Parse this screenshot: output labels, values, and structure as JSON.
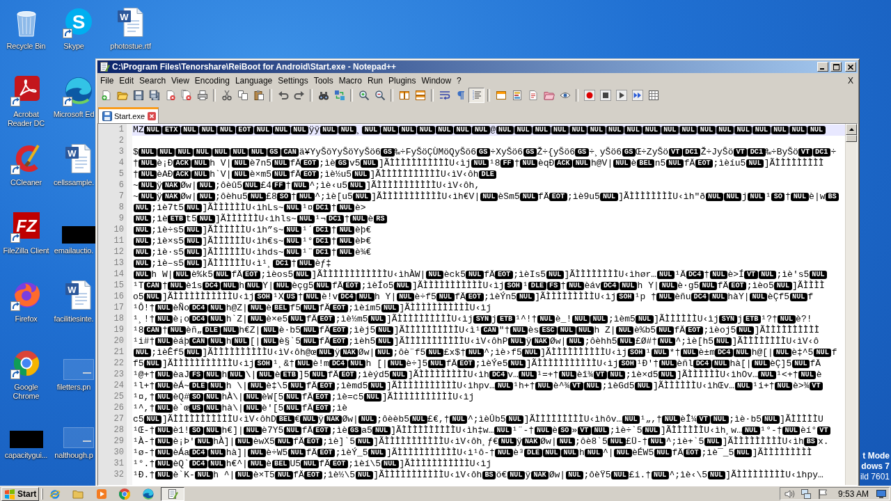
{
  "desktop": {
    "columns": [
      [
        {
          "label": "Recycle Bin",
          "shortcut": false
        },
        {
          "label": "Acrobat Reader DC",
          "shortcut": true
        },
        {
          "label": "CCleaner",
          "shortcut": true
        },
        {
          "label": "FileZilla Client",
          "shortcut": true,
          "glyph": "FZ"
        },
        {
          "label": "Firefox",
          "shortcut": true
        },
        {
          "label": "Google Chrome",
          "shortcut": true
        },
        {
          "label": "capacitygui...",
          "shortcut": false
        }
      ],
      [
        {
          "label": "Skype",
          "shortcut": true,
          "glyph": "S"
        },
        {
          "label": "Microsoft Ed",
          "shortcut": true
        },
        {
          "label": "cellssample.",
          "shortcut": false,
          "glyph": "W"
        },
        {
          "label": "emailauctio.",
          "shortcut": false
        },
        {
          "label": "facilitiesinte.",
          "shortcut": false,
          "glyph": "W"
        },
        {
          "label": "filetters.pn",
          "shortcut": false
        },
        {
          "label": "nalthough.p",
          "shortcut": false
        }
      ],
      [
        {
          "label": "photostue.rtf",
          "shortcut": false,
          "glyph": "W"
        }
      ]
    ],
    "notice": [
      "t Mode",
      "dows 7",
      "ild 7601"
    ]
  },
  "window": {
    "title": "C:\\Program Files\\Tenorshare\\ReiBoot for Android\\Start.exe - Notepad++"
  },
  "menu": {
    "items": [
      "File",
      "Edit",
      "Search",
      "View",
      "Encoding",
      "Language",
      "Settings",
      "Tools",
      "Macro",
      "Run",
      "Plugins",
      "Window",
      "?"
    ],
    "close": "X"
  },
  "toolbar": [
    [
      {
        "pressed": false
      },
      {
        "pressed": false
      },
      {
        "pressed": false
      },
      {
        "pressed": false
      },
      {
        "pressed": false
      },
      {
        "pressed": false
      },
      {
        "pressed": false
      }
    ],
    [
      {
        "pressed": false
      },
      {
        "pressed": false
      },
      {
        "pressed": false
      }
    ],
    [
      {
        "pressed": false
      },
      {
        "pressed": false
      }
    ],
    [
      {
        "pressed": false
      },
      {
        "pressed": false
      }
    ],
    [
      {
        "pressed": false
      },
      {
        "pressed": false
      }
    ],
    [
      {
        "pressed": false
      },
      {
        "pressed": false
      }
    ],
    [
      {
        "pressed": false
      },
      {
        "pressed": false
      },
      {
        "pressed": true
      }
    ],
    [
      {
        "pressed": false
      },
      {
        "pressed": false
      },
      {
        "pressed": false
      },
      {
        "pressed": false
      },
      {
        "pressed": false
      }
    ],
    [
      {
        "pressed": false
      },
      {
        "pressed": false
      },
      {
        "pressed": false
      },
      {
        "pressed": false
      },
      {
        "pressed": false
      }
    ]
  ],
  "tabs": [
    {
      "label": "Start.exe",
      "selected": true,
      "modified": false
    }
  ],
  "editor": {
    "lines": [
      {
        "number": "1",
        "current": true,
        "segments": [
          "MZ",
          [
            "NUL",
            "ETX",
            "NUL",
            "NUL",
            "NUL",
            "EOT",
            "NUL",
            "NUL",
            "NUL"
          ],
          "ÿÿ",
          [
            "NUL",
            "NUL"
          ],
          "¸",
          [
            "NUL",
            "NUL",
            "NUL",
            "NUL",
            "NUL",
            "NUL",
            "NUL"
          ],
          "@",
          [
            "NUL",
            "NUL",
            "NUL",
            "NUL",
            "NUL",
            "NUL",
            "NUL",
            "NUL",
            "NUL",
            "NUL",
            "NUL",
            "NUL",
            "NUL",
            "NUL",
            "NUL",
            "NUL",
            "NUL",
            "NUL"
          ]
        ]
      },
      {
        "number": "2",
        "current": false
      },
      {
        "number": "3",
        "current": false,
        "segments": [
          "$",
          [
            "NUL",
            "NUL",
            "NUL",
            "NUL",
            "NUL",
            "NUL",
            "NUL",
            "GS",
            "CAN"
          ],
          "ä¥YyŠöYyŠöYyŠö6",
          [
            "GS"
          ],
          "‰÷FyŠöÇÙMöQyŠö6",
          [
            "GS"
          ],
          "÷XyŠö6",
          [
            "GS"
          ],
          "Ž÷{yŠö6",
          [
            "GS"
          ],
          "÷¸yŠö6",
          [
            "GS"
          ],
          "Œ÷ZyŠö",
          [
            "VT",
            "DC1"
          ],
          "Ž÷JyŠö",
          [
            "VT",
            "DC1"
          ],
          "‰÷ByŠö",
          [
            "VT",
            "DC1"
          ],
          "÷"
        ]
      },
      {
        "number": "4",
        "current": false,
        "segments": [
          "†",
          [
            "NUL"
          ],
          "è¡Ð",
          [
            "ACK",
            "NUL"
          ],
          "h V|",
          [
            "NUL"
          ],
          "è7n5",
          [
            "NUL"
          ],
          "fÄ",
          [
            "EOT"
          ],
          ";ìè",
          [
            "GS"
          ],
          "v5",
          [
            "NUL"
          ],
          "]ÃÌÌÌÌÌÌÌÌÌÌÌU‹ìj",
          [
            "NUL"
          ],
          "¹8",
          [
            "FF"
          ],
          "†",
          [
            "NUL"
          ],
          "èqÐ",
          [
            "ACK",
            "NUL"
          ],
          "h@V|",
          [
            "NUL"
          ],
          "è",
          [
            "BEL"
          ],
          "n5",
          [
            "NUL"
          ],
          "fÄ",
          [
            "EOT"
          ],
          ";ìèíu5",
          [
            "NUL"
          ],
          "]ÃÌÌÌÌÌÌÌÌÌ"
        ]
      },
      {
        "number": "5",
        "current": false,
        "segments": [
          "†",
          [
            "NUL"
          ],
          "èAÐ",
          [
            "ACK",
            "NUL"
          ],
          "h`V|",
          [
            "NUL"
          ],
          "è×m5",
          [
            "NUL"
          ],
          "fÄ",
          [
            "EOT"
          ],
          ";ìè½u5",
          [
            "NUL"
          ],
          "]ÃÌÌÌÌÌÌÌÌÌÌÌU‹ìV‹ôh",
          [
            "DLE"
          ]
        ]
      },
      {
        "number": "6",
        "current": false,
        "segments": [
          "~",
          [
            "NUL"
          ],
          "ÿ",
          [
            "NAK"
          ],
          "Øw|",
          [
            "NUL"
          ],
          ";ôèû5",
          [
            "NUL"
          ],
          "£4",
          [
            "FF"
          ],
          "†",
          [
            "NUL"
          ],
          "^;ìè‹u5",
          [
            "NUL"
          ],
          "]ÃÌÌÌÌÌÌÌÌÌÌÌU‹ìV‹ôh,"
        ]
      },
      {
        "number": "7",
        "current": false,
        "segments": [
          "~",
          [
            "NUL"
          ],
          "ÿ",
          [
            "NAK"
          ],
          "Øw|",
          [
            "NUL"
          ],
          ";ôèhu5",
          [
            "NUL"
          ],
          "£8",
          [
            "SO"
          ],
          "†",
          [
            "NUL"
          ],
          "^;ìè[u5",
          [
            "NUL"
          ],
          "]ÃÌÌÌÌÌÌÌÌÌÌÌU‹ìh€V|",
          [
            "NUL"
          ],
          "èSm5",
          [
            "NUL"
          ],
          "fÄ",
          [
            "EOT"
          ],
          ";ìè9u5",
          [
            "NUL"
          ],
          "]ÃÌÌÌÌÌÌÌÌU‹ìh\"ð",
          [
            "NUL",
            "NUL"
          ],
          "j",
          [
            "NUL"
          ],
          "¹",
          [
            "SO"
          ],
          "†",
          [
            "NUL"
          ],
          "è|w",
          [
            "BS"
          ]
        ]
      },
      {
        "number": "8",
        "current": false,
        "segments": [
          [
            "NUL"
          ],
          ";ìè7t5",
          [
            "NUL"
          ],
          "]ÃÌÌÌÌÌÌU‹ìhLs~",
          [
            "NUL"
          ],
          "¹¤",
          [
            "DC1"
          ],
          "†",
          [
            "NUL"
          ],
          "è>"
        ]
      },
      {
        "number": "9",
        "current": false,
        "segments": [
          [
            "NUL"
          ],
          ";ìè",
          [
            "ETB"
          ],
          "t5",
          [
            "NUL"
          ],
          "]ÃÌÌÌÌÌÌU‹ìhls~",
          [
            "NUL"
          ],
          "¹¬",
          [
            "DC1"
          ],
          "†",
          [
            "NUL"
          ],
          "è",
          [
            "RS"
          ]
        ]
      },
      {
        "number": "10",
        "current": false,
        "segments": [
          [
            "NUL"
          ],
          ";ìè÷s5",
          [
            "NUL"
          ],
          "]ÃÌÌÌÌÌÌU‹ìh”s~",
          [
            "NUL"
          ],
          "¹´",
          [
            "DC1"
          ],
          "†",
          [
            "NUL"
          ],
          "èþ€"
        ]
      },
      {
        "number": "11",
        "current": false,
        "segments": [
          [
            "NUL"
          ],
          ";ìè×s5",
          [
            "NUL"
          ],
          "]ÃÌÌÌÌÌÌU‹ìh€s~",
          [
            "NUL"
          ],
          "¹°",
          [
            "DC1"
          ],
          "†",
          [
            "NUL"
          ],
          "èÞ€"
        ]
      },
      {
        "number": "12",
        "current": false,
        "segments": [
          [
            "NUL"
          ],
          ";ìè·s5",
          [
            "NUL"
          ],
          "]ÃÌÌÌÌÌÌU‹ìhds~",
          [
            "NUL"
          ],
          "¹¨",
          [
            "DC1"
          ],
          "†",
          [
            "NUL"
          ],
          "è¾€"
        ]
      },
      {
        "number": "13",
        "current": false,
        "segments": [
          [
            "NUL"
          ],
          ";ìè–s5",
          [
            "NUL"
          ],
          "]ÃÌÌÌÌÌÌU‹ì¹¸",
          [
            "DC1"
          ],
          "†",
          [
            "NUL"
          ],
          "èƒ‡"
        ]
      },
      {
        "number": "14",
        "current": false,
        "segments": [
          [
            "NUL"
          ],
          "h W|",
          [
            "NUL"
          ],
          "è%k5",
          [
            "NUL"
          ],
          "fÄ",
          [
            "EOT"
          ],
          ";ìèos5",
          [
            "NUL"
          ],
          "]ÃÌÌÌÌÌÌÌÌÌÌÌÌU‹ìhÀW|",
          [
            "NUL"
          ],
          "èck5",
          [
            "NUL"
          ],
          "fÄ",
          [
            "EOT"
          ],
          ";ìèIs5",
          [
            "NUL"
          ],
          "]ÃÌÌÌÌÌÌÌÌU‹ìhør…",
          [
            "NUL"
          ],
          "¹Ä",
          [
            "DC4"
          ],
          "†",
          [
            "NUL"
          ],
          "è>Í",
          [
            "VT",
            "NUL"
          ],
          ";ìè's5",
          [
            "NUL"
          ]
        ]
      },
      {
        "number": "15",
        "current": false,
        "segments": [
          "¹T",
          [
            "CAN"
          ],
          "†",
          [
            "NUL"
          ],
          "è1s",
          [
            "DC4",
            "NUL"
          ],
          "h",
          [
            "NUL"
          ],
          "Y|",
          [
            "NUL"
          ],
          "èçg5",
          [
            "NUL"
          ],
          "fÄ",
          [
            "EOT"
          ],
          ";ìèÍo5",
          [
            "NUL"
          ],
          "]ÃÌÌÌÌÌÌÌÌÌÌÌU‹ìj",
          [
            "SOH"
          ],
          "¹",
          [
            "DLE",
            "FS"
          ],
          "†",
          [
            "NUL"
          ],
          "èáv",
          [
            "DC4",
            "NUL"
          ],
          "h Y|",
          [
            "NUL"
          ],
          "è·g5",
          [
            "NUL"
          ],
          "fÄ",
          [
            "EOT"
          ],
          ";ìèo5",
          [
            "NUL"
          ],
          "]ÃÌÌÌÌ"
        ]
      },
      {
        "number": "16",
        "current": false,
        "segments": [
          "o5",
          [
            "NUL"
          ],
          "]ÃÌÌÌÌÌÌÌÌÌÌÌU‹ìj",
          [
            "SOH"
          ],
          "¹X",
          [
            "US"
          ],
          "†",
          [
            "NUL"
          ],
          "è!v",
          [
            "DC4",
            "NUL"
          ],
          "h Y|",
          [
            "NUL"
          ],
          "è÷f5",
          [
            "NUL"
          ],
          "fÄ",
          [
            "EOT"
          ],
          ";ìèÝn5",
          [
            "NUL"
          ],
          "]ÃÌÌÌÌÌÌÌÌÌU‹ìj",
          [
            "SOH"
          ],
          "¹p †",
          [
            "NUL"
          ],
          "èñu",
          [
            "DC4",
            "NUL"
          ],
          "hàY|",
          [
            "NUL"
          ],
          "èÇf5",
          [
            "NUL"
          ],
          "f"
        ]
      },
      {
        "number": "17",
        "current": false,
        "segments": [
          "¹Ô!†",
          [
            "NUL"
          ],
          "èÑo",
          [
            "DC4",
            "NUL"
          ],
          "h@Z|",
          [
            "NUL"
          ],
          "è",
          [
            "BEL"
          ],
          "f5",
          [
            "NUL"
          ],
          "fÄ",
          [
            "EOT"
          ],
          ";ìèím5",
          [
            "NUL"
          ],
          "]ÃÌÌÌÌÌÌÌÌÌÌÌU‹ìj"
        ]
      },
      {
        "number": "18",
        "current": false,
        "segments": [
          "¹¸!†",
          [
            "NUL"
          ],
          "è¡o",
          [
            "DC4",
            "NUL"
          ],
          "h`Z|",
          [
            "NUL"
          ],
          "è×e5",
          [
            "NUL"
          ],
          "fÄ",
          [
            "EOT"
          ],
          ";ìè½m5",
          [
            "NUL"
          ],
          "]ÃÌÌÌÌÌÌÌÌÌÌU‹ìj",
          [
            "SYN"
          ],
          "j",
          [
            "ETB"
          ],
          "¹^!†",
          [
            "NUL"
          ],
          "è_!",
          [
            "NUL",
            "NUL"
          ],
          ";ìèm5",
          [
            "NUL"
          ],
          "]ÃÌÌÌÌÌÌU‹ìj",
          [
            "SYN"
          ],
          "j",
          [
            "ETB"
          ],
          "¹?†",
          [
            "NUL"
          ],
          "è?!"
        ]
      },
      {
        "number": "19",
        "current": false,
        "segments": [
          "¹8",
          [
            "CAN"
          ],
          "†",
          [
            "NUL"
          ],
          "èñ„",
          [
            "DLE",
            "NUL"
          ],
          "h€Z|",
          [
            "NUL"
          ],
          "è·b5",
          [
            "NUL"
          ],
          "fÄ",
          [
            "EOT"
          ],
          ";ìèj5",
          [
            "NUL"
          ],
          "]ÃÌÌÌÌÌÌÌÌÌÌU‹ì¹",
          [
            "CAN"
          ],
          "\"†",
          [
            "NUL"
          ],
          "ès",
          [
            "ESC",
            "NUL",
            "NUL"
          ],
          "h Z|",
          [
            "NUL"
          ],
          "è%b5",
          [
            "NUL"
          ],
          "fÄ",
          [
            "EOT"
          ],
          ";ìèoj5",
          [
            "NUL"
          ],
          "]ÃÌÌÌÌÌÌÌÌÌÌ"
        ]
      },
      {
        "number": "20",
        "current": false,
        "segments": [
          "¹i#†",
          [
            "NUL"
          ],
          "èáþ",
          [
            "CAN",
            "NUL"
          ],
          "h",
          [
            "NUL"
          ],
          "[|",
          [
            "NUL"
          ],
          "è§`5",
          [
            "NUL"
          ],
          "fÄ",
          [
            "EOT"
          ],
          ";ìèh5",
          [
            "NUL"
          ],
          "]ÃÌÌÌÌÌÌÌÌÌÌÌU‹ìV‹ôhP",
          [
            "NUL"
          ],
          "ÿ",
          [
            "NAK"
          ],
          "Øw|",
          [
            "NUL"
          ],
          ";ôèhh5",
          [
            "NUL"
          ],
          "£Ø#†",
          [
            "NUL"
          ],
          "^;ìè[h5",
          [
            "NUL"
          ],
          "]ÃÌÌÌÌÌÌÌÌU‹ìV‹ô"
        ]
      },
      {
        "number": "21",
        "current": false,
        "segments": [
          [
            "NUL"
          ],
          ";ìèÊf5",
          [
            "NUL"
          ],
          "]ÃÌÌÌÌÌÌÌÌÌÌU‹ìV‹ôh@œ",
          [
            "NUL"
          ],
          "ÿ",
          [
            "NAK"
          ],
          "Øw|",
          [
            "NUL"
          ],
          ";ôè¨f5",
          [
            "NUL"
          ],
          "£x$†",
          [
            "NUL"
          ],
          "^;ìè›f5",
          [
            "NUL"
          ],
          "]ÃÌÌÌÌÌÌÌÌÌÌU‹ìj",
          [
            "SOH"
          ],
          "¹",
          [
            "NUL"
          ],
          "*†",
          [
            "NUL"
          ],
          "è±m",
          [
            "DC4",
            "NUL"
          ],
          "h@[|",
          [
            "NUL"
          ],
          "è‡^5",
          [
            "NUL"
          ],
          "f"
        ]
      },
      {
        "number": "22",
        "current": false,
        "segments": [
          "f5",
          [
            "NUL"
          ],
          "]ÃÌÌÌÌÌÌÌÌÌÌÌU‹ìj",
          [
            "SOH"
          ],
          "¹¸&†",
          [
            "NUL"
          ],
          "è!m",
          [
            "DC4",
            "NUL"
          ],
          "h [|",
          [
            "NUL"
          ],
          "è÷]5",
          [
            "NUL"
          ],
          "fÄ",
          [
            "EOT"
          ],
          ";ìèÝe5",
          [
            "NUL"
          ],
          "]ÃÌÌÌÌÌÌÌÌÌÌÌU‹ìj",
          [
            "SOH"
          ],
          "¹Ð'†",
          [
            "NUL"
          ],
          "èñl",
          [
            "DC4",
            "NUL"
          ],
          "hà[|",
          [
            "NUL"
          ],
          "èÇ]5",
          [
            "NUL"
          ],
          "fÄ"
        ]
      },
      {
        "number": "23",
        "current": false,
        "segments": [
          "¹@+†",
          [
            "NUL"
          ],
          "èaJ",
          [
            "FS",
            "NUL"
          ],
          "h",
          [
            "NUL"
          ],
          "\\|",
          [
            "NUL"
          ],
          "è",
          [
            "ETB"
          ],
          "]5",
          [
            "NUL"
          ],
          "fÄ",
          [
            "EOT"
          ],
          ";ìèýd5",
          [
            "NUL"
          ],
          "]ÃÌÌÌÌÌÌÌÌÌU‹ìh",
          [
            "DC4"
          ],
          "v…",
          [
            "NUL"
          ],
          "¹=+†",
          [
            "NUL"
          ],
          "èî¾",
          [
            "VT",
            "NUL"
          ],
          ";ìè×d5",
          [
            "NUL"
          ],
          "]ÃÌÌÌÌÌÌU‹ìhOv…",
          [
            "NUL"
          ],
          "¹<+†",
          [
            "NUL"
          ],
          "è"
        ]
      },
      {
        "number": "24",
        "current": false,
        "segments": [
          "¹l+†",
          [
            "NUL"
          ],
          "èÁ~",
          [
            "DLE",
            "NUL"
          ],
          "h \\|",
          [
            "NUL"
          ],
          "è‡\\5",
          [
            "NUL"
          ],
          "fÄ",
          [
            "EOT"
          ],
          ";ìèmd5",
          [
            "NUL"
          ],
          "]ÃÌÌÌÌÌÌÌÌÌÌÌU‹ìhpv…",
          [
            "NUL"
          ],
          "¹h+†",
          [
            "NUL"
          ],
          "è^¾",
          [
            "VT",
            "NUL"
          ],
          ";ìèGd5",
          [
            "NUL"
          ],
          "]ÃÌÌÌÌÌÌU‹ìhŒv…",
          [
            "NUL"
          ],
          "¹i+†",
          [
            "NUL"
          ],
          "è>¾",
          [
            "VT"
          ]
        ]
      },
      {
        "number": "25",
        "current": false,
        "segments": [
          "¹¤,†",
          [
            "NUL"
          ],
          "èQ#",
          [
            "SO",
            "NUL"
          ],
          "hÀ\\|",
          [
            "NUL"
          ],
          "èW[5",
          [
            "NUL"
          ],
          "fÄ",
          [
            "EOT"
          ],
          ";ìè=c5",
          [
            "NUL"
          ],
          "]ÃÌÌÌÌÌÌÌÌÌÌÌU‹ìj"
        ]
      },
      {
        "number": "26",
        "current": false,
        "segments": [
          "¹^,†",
          [
            "NUL"
          ],
          "è`œ",
          [
            "US",
            "NUL"
          ],
          "hà\\|",
          [
            "NUL"
          ],
          "è'[5",
          [
            "NUL"
          ],
          "fÄ",
          [
            "EOT"
          ],
          ";ìè"
        ]
      },
      {
        "number": "27",
        "current": false,
        "segments": [
          "c5",
          [
            "NUL"
          ],
          "]ÃÌÌÌÌÌÌÌÌÌÌÌU‹ìV‹ôhD",
          [
            "BEL"
          ],
          "€",
          [
            "NUL"
          ],
          "ÿ",
          [
            "NAK"
          ],
          "Øw|",
          [
            "NUL"
          ],
          ";ôèèb5",
          [
            "NUL"
          ],
          "£€,†",
          [
            "NUL"
          ],
          "^;ìèÛb5",
          [
            "NUL"
          ],
          "]ÃÌÌÌÌÌÌÌÌÌU‹ìhôv…",
          [
            "NUL"
          ],
          "¹„,†",
          [
            "NUL"
          ],
          "èÎ¼",
          [
            "VT",
            "NUL"
          ],
          ";ìè·b5",
          [
            "NUL"
          ],
          "]ÃÌÌÌÌÌU"
        ]
      },
      {
        "number": "28",
        "current": false,
        "segments": [
          "¹Œ-†",
          [
            "NUL"
          ],
          "è1!",
          [
            "SO",
            "NUL"
          ],
          "h€]|",
          [
            "NUL"
          ],
          "è7Y5",
          [
            "NUL"
          ],
          "fÄ",
          [
            "EOT"
          ],
          ";ìè",
          [
            "GS"
          ],
          "a5",
          [
            "NUL"
          ],
          "]ÃÌÌÌÌÌÌÌÌÌÌU‹ìh‡w…",
          [
            "NUL"
          ],
          "¹¨-†",
          [
            "NUL"
          ],
          "è",
          [
            "SO"
          ],
          "»",
          [
            "VT",
            "NUL"
          ],
          ";ìè÷`5",
          [
            "NUL"
          ],
          "]ÃÌÌÌÌÌÌU‹ìh¸w…",
          [
            "NUL"
          ],
          "¹°-†",
          [
            "NUL"
          ],
          "èí°",
          [
            "VT"
          ]
        ]
      },
      {
        "number": "29",
        "current": false,
        "segments": [
          "¹À-†",
          [
            "NUL"
          ],
          "è¡Þ'",
          [
            "NUL"
          ],
          "hÀ]|",
          [
            "NUL"
          ],
          "èwX5",
          [
            "NUL"
          ],
          "fÄ",
          [
            "EOT"
          ],
          ";ìè]`5",
          [
            "NUL"
          ],
          "]ÃÌÌÌÌÌÌÌÌÌÌÌU‹ìV‹ôh¸ƒ€",
          [
            "NUL"
          ],
          "ÿ",
          [
            "NAK"
          ],
          "Øw|",
          [
            "NUL"
          ],
          ";ôè8`5",
          [
            "NUL"
          ],
          "£Ü-†",
          [
            "NUL"
          ],
          "^;ìè+`5",
          [
            "NUL"
          ],
          "]ÃÌÌÌÌÌÌÌÌÌU‹ìh",
          [
            "BS"
          ],
          "x."
        ]
      },
      {
        "number": "30",
        "current": false,
        "segments": [
          "¹ø-†",
          [
            "NUL"
          ],
          "èÁa",
          [
            "DC4",
            "NUL"
          ],
          "hà]|",
          [
            "NUL"
          ],
          "è÷W5",
          [
            "NUL"
          ],
          "fÄ",
          [
            "EOT"
          ],
          ";ìèÝ_5",
          [
            "NUL"
          ],
          "]ÃÌÌÌÌÌÌÌÌÌÌÌU‹ì¹ô-†",
          [
            "NUL"
          ],
          "è³",
          [
            "DLE",
            "NUL",
            "NUL"
          ],
          "h",
          [
            "NUL"
          ],
          "^|",
          [
            "NUL"
          ],
          "èÉW5",
          [
            "NUL"
          ],
          "fÄ",
          [
            "EOT"
          ],
          ";ìè¯_5",
          [
            "NUL"
          ],
          "]ÃÌÌÌÌÌÌÌÌÌ"
        ]
      },
      {
        "number": "31",
        "current": false,
        "segments": [
          "¹°.†",
          [
            "NUL"
          ],
          "èQ`",
          [
            "DC4",
            "NUL"
          ],
          "h€^|",
          [
            "NUL"
          ],
          "è",
          [
            "BEL"
          ],
          "U5",
          [
            "NUL"
          ],
          "fÄ",
          [
            "EOT"
          ],
          ";ìèí\\5",
          [
            "NUL"
          ],
          "]ÃÌÌÌÌÌÌÌÌÌÌÌU‹ìj"
        ]
      },
      {
        "number": "32",
        "current": false,
        "segments": [
          "¹Ð.†",
          [
            "NUL"
          ],
          "è`K-",
          [
            "NUL"
          ],
          "h ^|",
          [
            "NUL"
          ],
          "è×T5",
          [
            "NUL"
          ],
          "fÄ",
          [
            "EOT"
          ],
          ";ìè½\\5",
          [
            "NUL"
          ],
          "]ÃÌÌÌÌÌÌÌÌÌÌÌU‹ìV‹ôh",
          [
            "BS"
          ],
          "ö€",
          [
            "NUL"
          ],
          "ÿ",
          [
            "NAK"
          ],
          "Øw|",
          [
            "NUL"
          ],
          ";ôèŸ5",
          [
            "NUL"
          ],
          "£i.†",
          [
            "NUL"
          ],
          "^;ìè‹\\5",
          [
            "NUL"
          ],
          "]ÃÌÌÌÌÌÌÌÌÌU‹ìhpy…"
        ]
      }
    ]
  },
  "taskbar": {
    "start": "Start",
    "tasks": [
      {
        "active": true
      }
    ],
    "clock": "9:53 AM"
  }
}
